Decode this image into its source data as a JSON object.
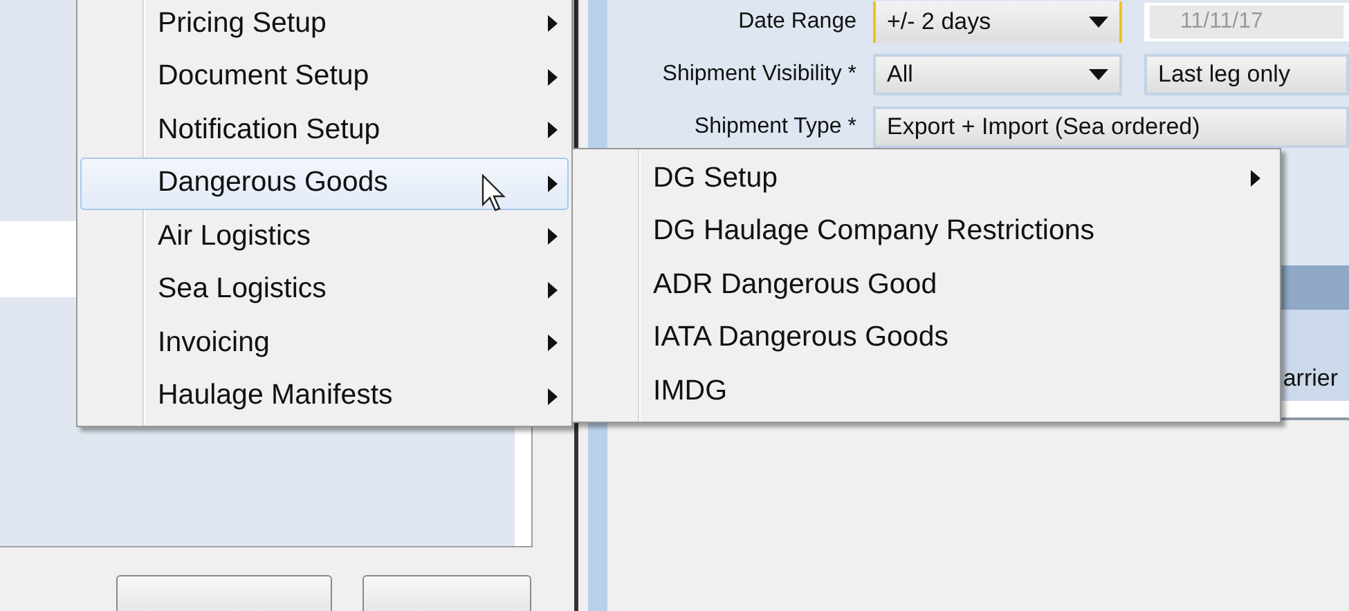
{
  "form": {
    "rows": [
      {
        "label": "Date Range",
        "value": "+/- 2 days",
        "warning": true,
        "secondary": {
          "kind": "date",
          "value": "11/11/17"
        }
      },
      {
        "label": "Shipment Visibility *",
        "value": "All",
        "warning": false,
        "secondary": {
          "kind": "select",
          "value": "Last leg only"
        }
      },
      {
        "label": "Shipment Type *",
        "value": "Export + Import (Sea ordered)",
        "warning": false
      }
    ]
  },
  "table": {
    "columns": [
      "arrier"
    ]
  },
  "menu": {
    "items": [
      {
        "label": "Pricing Setup",
        "selected": false,
        "has_submenu": true
      },
      {
        "label": "Document Setup",
        "selected": false,
        "has_submenu": true
      },
      {
        "label": "Notification Setup",
        "selected": false,
        "has_submenu": true
      },
      {
        "label": "Dangerous Goods",
        "selected": true,
        "has_submenu": true
      },
      {
        "label": "Air Logistics",
        "selected": false,
        "has_submenu": true
      },
      {
        "label": "Sea Logistics",
        "selected": false,
        "has_submenu": true
      },
      {
        "label": "Invoicing",
        "selected": false,
        "has_submenu": true
      },
      {
        "label": "Haulage Manifests",
        "selected": false,
        "has_submenu": true
      }
    ]
  },
  "submenu": {
    "items": [
      {
        "label": "DG Setup",
        "has_submenu": true
      },
      {
        "label": "DG Haulage Company Restrictions",
        "has_submenu": false
      },
      {
        "label": "ADR Dangerous Good",
        "has_submenu": false
      },
      {
        "label": "IATA Dangerous Goods",
        "has_submenu": false
      },
      {
        "label": "IMDG",
        "has_submenu": false
      }
    ]
  }
}
